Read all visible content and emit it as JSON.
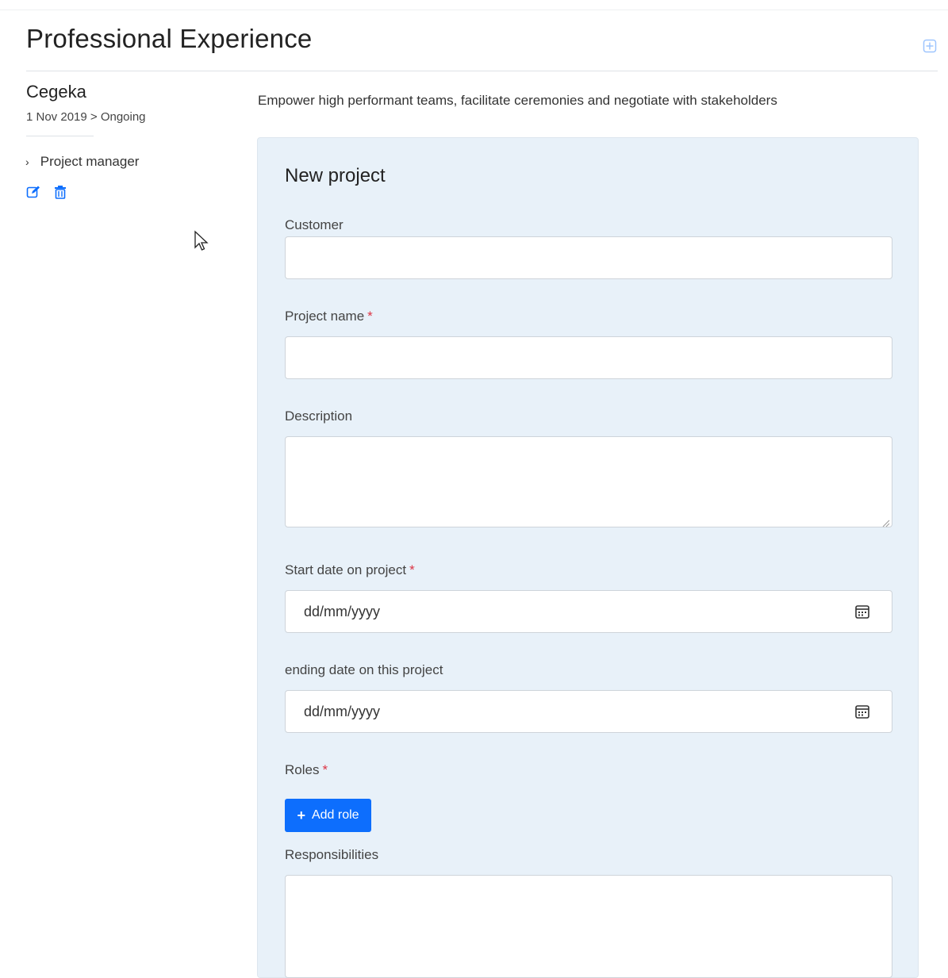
{
  "page": {
    "title": "Professional Experience"
  },
  "experience": {
    "company": "Cegeka",
    "period": "1 Nov 2019 > Ongoing",
    "role_item": "Project manager",
    "description": "Empower high performant teams, facilitate ceremonies and negotiate with stakeholders"
  },
  "form": {
    "title": "New project",
    "customer_label": "Customer",
    "project_name_label": "Project name",
    "description_label": "Description",
    "start_date_label": "Start date on project",
    "end_date_label": "ending date on this project",
    "date_placeholder": "dd/mm/yyyy",
    "roles_label": "Roles",
    "add_role_button": "Add role",
    "responsibilities_label": "Responsibilities",
    "required_marker": "*"
  },
  "colors": {
    "accent": "#0d6efd",
    "required": "#dc3545",
    "card_bg": "#e8f1f9"
  },
  "icons": [
    "expand-icon",
    "chevron-right-icon",
    "edit-icon",
    "trash-icon",
    "calendar-icon",
    "plus-icon",
    "mouse-cursor-icon"
  ]
}
